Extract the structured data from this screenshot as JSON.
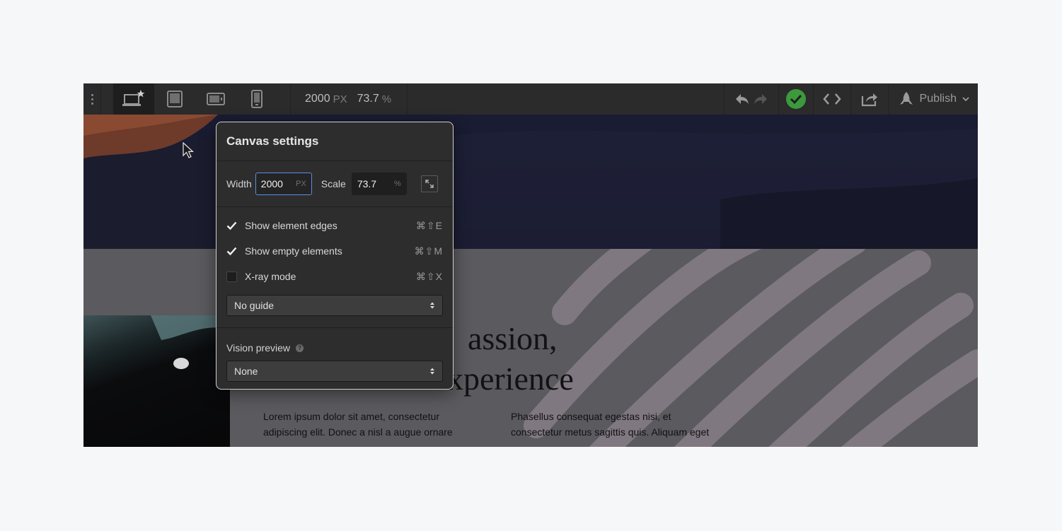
{
  "toolbar": {
    "devices": [
      "desktop-base-icon",
      "tablet-icon",
      "mobile-landscape-icon",
      "mobile-portrait-icon"
    ],
    "width_value": "2000",
    "width_unit": "PX",
    "scale_value": "73.7",
    "scale_unit": "%",
    "publish_label": "Publish"
  },
  "canvas": {
    "headline_line1": "assion,",
    "headline_line2": "xperience",
    "col1_lines": [
      "Lorem ipsum dolor sit amet, consectetur",
      "adipiscing elit. Donec a nisl a augue ornare"
    ],
    "col2_lines": [
      "Phasellus consequat egestas nisi, et",
      "consectetur metus sagittis quis. Aliquam eget"
    ]
  },
  "popover": {
    "title": "Canvas settings",
    "width_label": "Width",
    "width_value": "2000",
    "width_unit": "PX",
    "scale_label": "Scale",
    "scale_value": "73.7",
    "scale_unit": "%",
    "options": [
      {
        "label": "Show element edges",
        "shortcut": "⌘⇧E",
        "checked": true
      },
      {
        "label": "Show empty elements",
        "shortcut": "⌘⇧M",
        "checked": true
      },
      {
        "label": "X-ray mode",
        "shortcut": "⌘⇧X",
        "checked": false
      }
    ],
    "guide_select": "No guide",
    "vision_label": "Vision preview",
    "vision_select": "None"
  },
  "colors": {
    "accent": "#5a8ee6",
    "success": "#3c9a3c"
  }
}
